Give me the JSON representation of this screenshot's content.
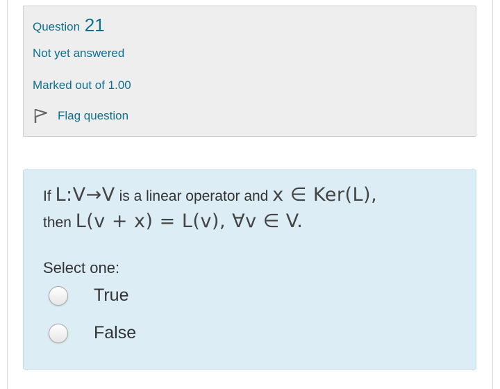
{
  "info": {
    "question_word": "Question",
    "question_number": "21",
    "state": "Not yet answered",
    "grade": "Marked out of 1.00",
    "flag_label": "Flag question",
    "flag_icon": "flag-icon"
  },
  "question": {
    "text_part1": "If",
    "math1": "L:V→V",
    "text_part2": "is a linear operator and",
    "math2": "x ∈ Ker(L),",
    "text_part3": "then",
    "math3": "L(v + x) = L(v), ∀v ∈ V.",
    "prompt": "Select one:",
    "options": [
      {
        "label": "True",
        "selected": false
      },
      {
        "label": "False",
        "selected": false
      }
    ]
  },
  "colors": {
    "link": "#0f6f8f",
    "info_bg": "#eeeeee",
    "question_bg": "#dcedf5",
    "question_border": "#b9dbe9"
  }
}
